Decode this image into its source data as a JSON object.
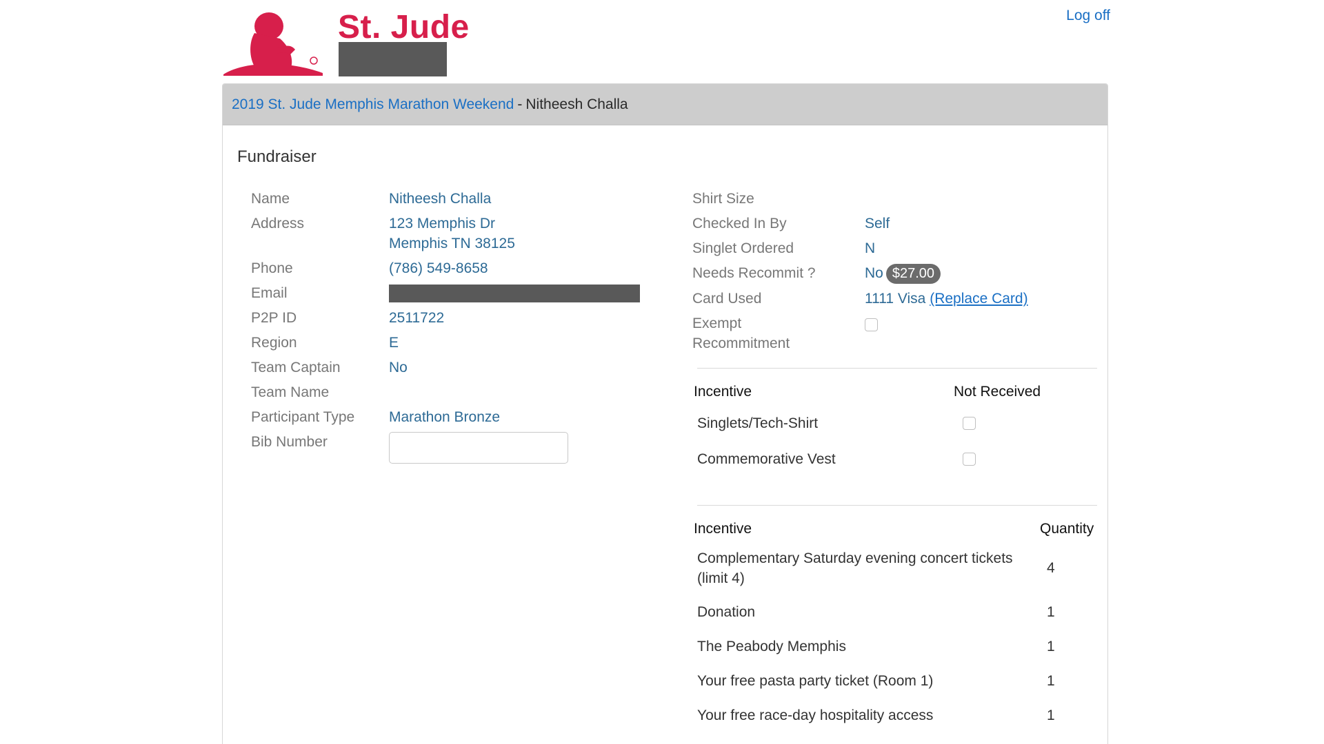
{
  "header": {
    "brand_name": "St. Jude",
    "logoff_label": "Log off",
    "logo_icon": "st-jude-child-logo-icon",
    "brand_color": "#d71f4b"
  },
  "breadcrumb": {
    "event_link": "2019 St. Jude Memphis Marathon Weekend",
    "separator": "-",
    "participant": "Nitheesh Challa"
  },
  "section_title": "Fundraiser",
  "details_left": {
    "name_label": "Name",
    "name_value": "Nitheesh Challa",
    "address_label": "Address",
    "address_line1": "123 Memphis Dr",
    "address_line2": "Memphis TN 38125",
    "phone_label": "Phone",
    "phone_value": "(786) 549-8658",
    "email_label": "Email",
    "p2p_label": "P2P ID",
    "p2p_value": "2511722",
    "region_label": "Region",
    "region_value": "E",
    "captain_label": "Team Captain",
    "captain_value": "No",
    "team_label": "Team Name",
    "team_value": "",
    "ptype_label": "Participant Type",
    "ptype_value": "Marathon Bronze",
    "bib_label": "Bib Number",
    "bib_value": ""
  },
  "details_right": {
    "shirt_label": "Shirt Size",
    "shirt_value": "",
    "checkedin_label": "Checked In By",
    "checkedin_value": "Self",
    "singlet_label": "Singlet Ordered",
    "singlet_value": "N",
    "recommit_label": "Needs Recommit ?",
    "recommit_value": "No",
    "recommit_amount": "$27.00",
    "card_label": "Card Used",
    "card_value": "1111 Visa",
    "replace_card": "(Replace Card)",
    "exempt_label_line1": "Exempt",
    "exempt_label_line2": "Recommitment"
  },
  "not_received_table": {
    "col_incentive": "Incentive",
    "col_status": "Not Received",
    "rows": [
      {
        "name": "Singlets/Tech-Shirt"
      },
      {
        "name": "Commemorative Vest"
      }
    ]
  },
  "quantity_table": {
    "col_incentive": "Incentive",
    "col_quantity": "Quantity",
    "rows": [
      {
        "name_line1": "Complementary Saturday evening concert tickets",
        "name_line2": "(limit 4)",
        "qty": "4"
      },
      {
        "name_line1": "Donation",
        "qty": "1"
      },
      {
        "name_line1": "The Peabody Memphis",
        "qty": "1"
      },
      {
        "name_line1": "Your free pasta party ticket (Room 1)",
        "qty": "1"
      },
      {
        "name_line1": "Your free race-day hospitality access",
        "qty": "1"
      }
    ]
  }
}
